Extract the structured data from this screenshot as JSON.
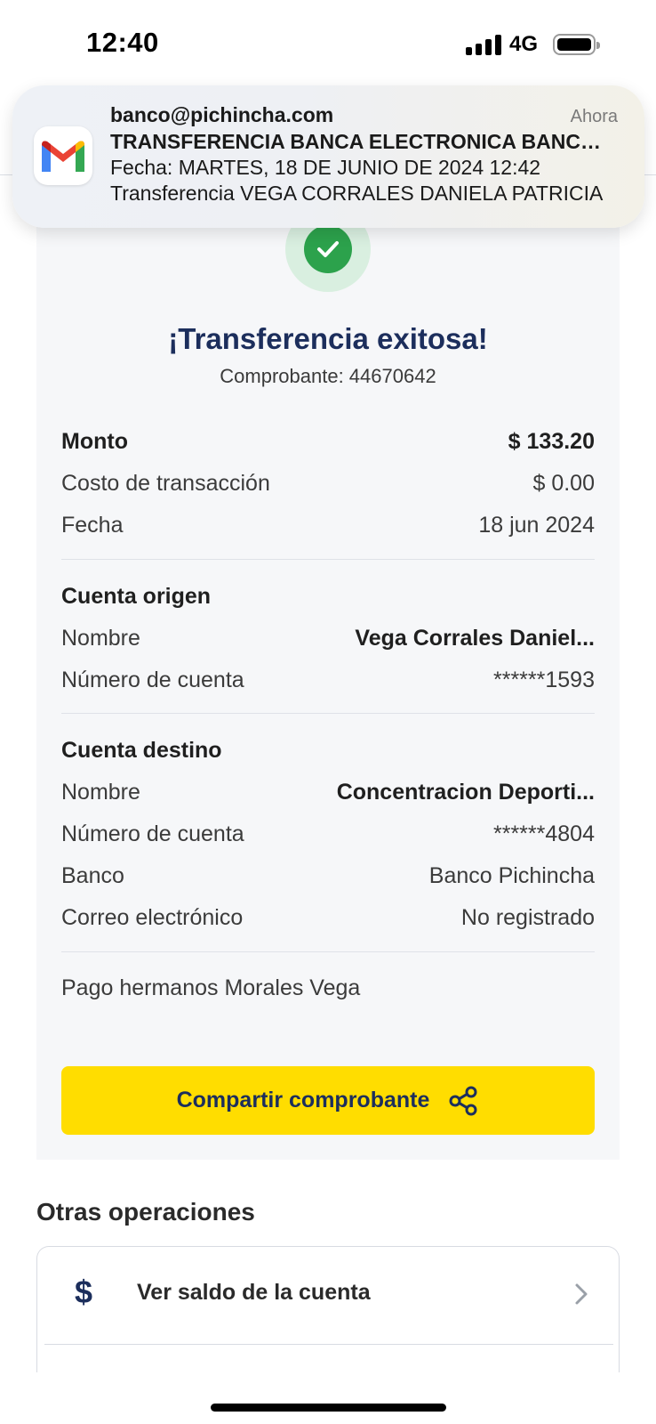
{
  "status_bar": {
    "time": "12:40",
    "network": "4G"
  },
  "notification": {
    "app_icon": "gmail-icon",
    "sender": "banco@pichincha.com",
    "time": "Ahora",
    "subject": "TRANSFERENCIA BANCA ELECTRONICA BANCA MOVIL",
    "line1": "Fecha: MARTES, 18 DE JUNIO DE 2024 12:42",
    "line2": "Transferencia VEGA CORRALES DANIELA PATRICIA"
  },
  "receipt": {
    "success_icon": "check-icon",
    "title": "¡Transferencia exitosa!",
    "receipt_number": "Comprobante: 44670642",
    "summary": {
      "amount_label": "Monto",
      "amount_value": "$ 133.20",
      "fee_label": "Costo de transacción",
      "fee_value": "$ 0.00",
      "date_label": "Fecha",
      "date_value": "18 jun 2024"
    },
    "origin": {
      "heading": "Cuenta origen",
      "name_label": "Nombre",
      "name_value": "Vega  Corrales Daniel...",
      "account_label": "Número de cuenta",
      "account_value": "******1593"
    },
    "destination": {
      "heading": "Cuenta destino",
      "name_label": "Nombre",
      "name_value": "Concentracion Deporti...",
      "account_label": "Número de cuenta",
      "account_value": "******4804",
      "bank_label": "Banco",
      "bank_value": "Banco Pichincha",
      "email_label": "Correo electrónico",
      "email_value": "No registrado"
    },
    "memo": "Pago hermanos Morales Vega",
    "share_button": "Compartir comprobante",
    "share_icon": "share-icon"
  },
  "other_operations": {
    "title": "Otras operaciones",
    "items": [
      {
        "label": "Ver saldo de la cuenta",
        "icon": "dollar-icon"
      }
    ]
  },
  "colors": {
    "brand_navy": "#1c2e5c",
    "brand_yellow": "#ffdd00",
    "success_green": "#2ca24c"
  }
}
